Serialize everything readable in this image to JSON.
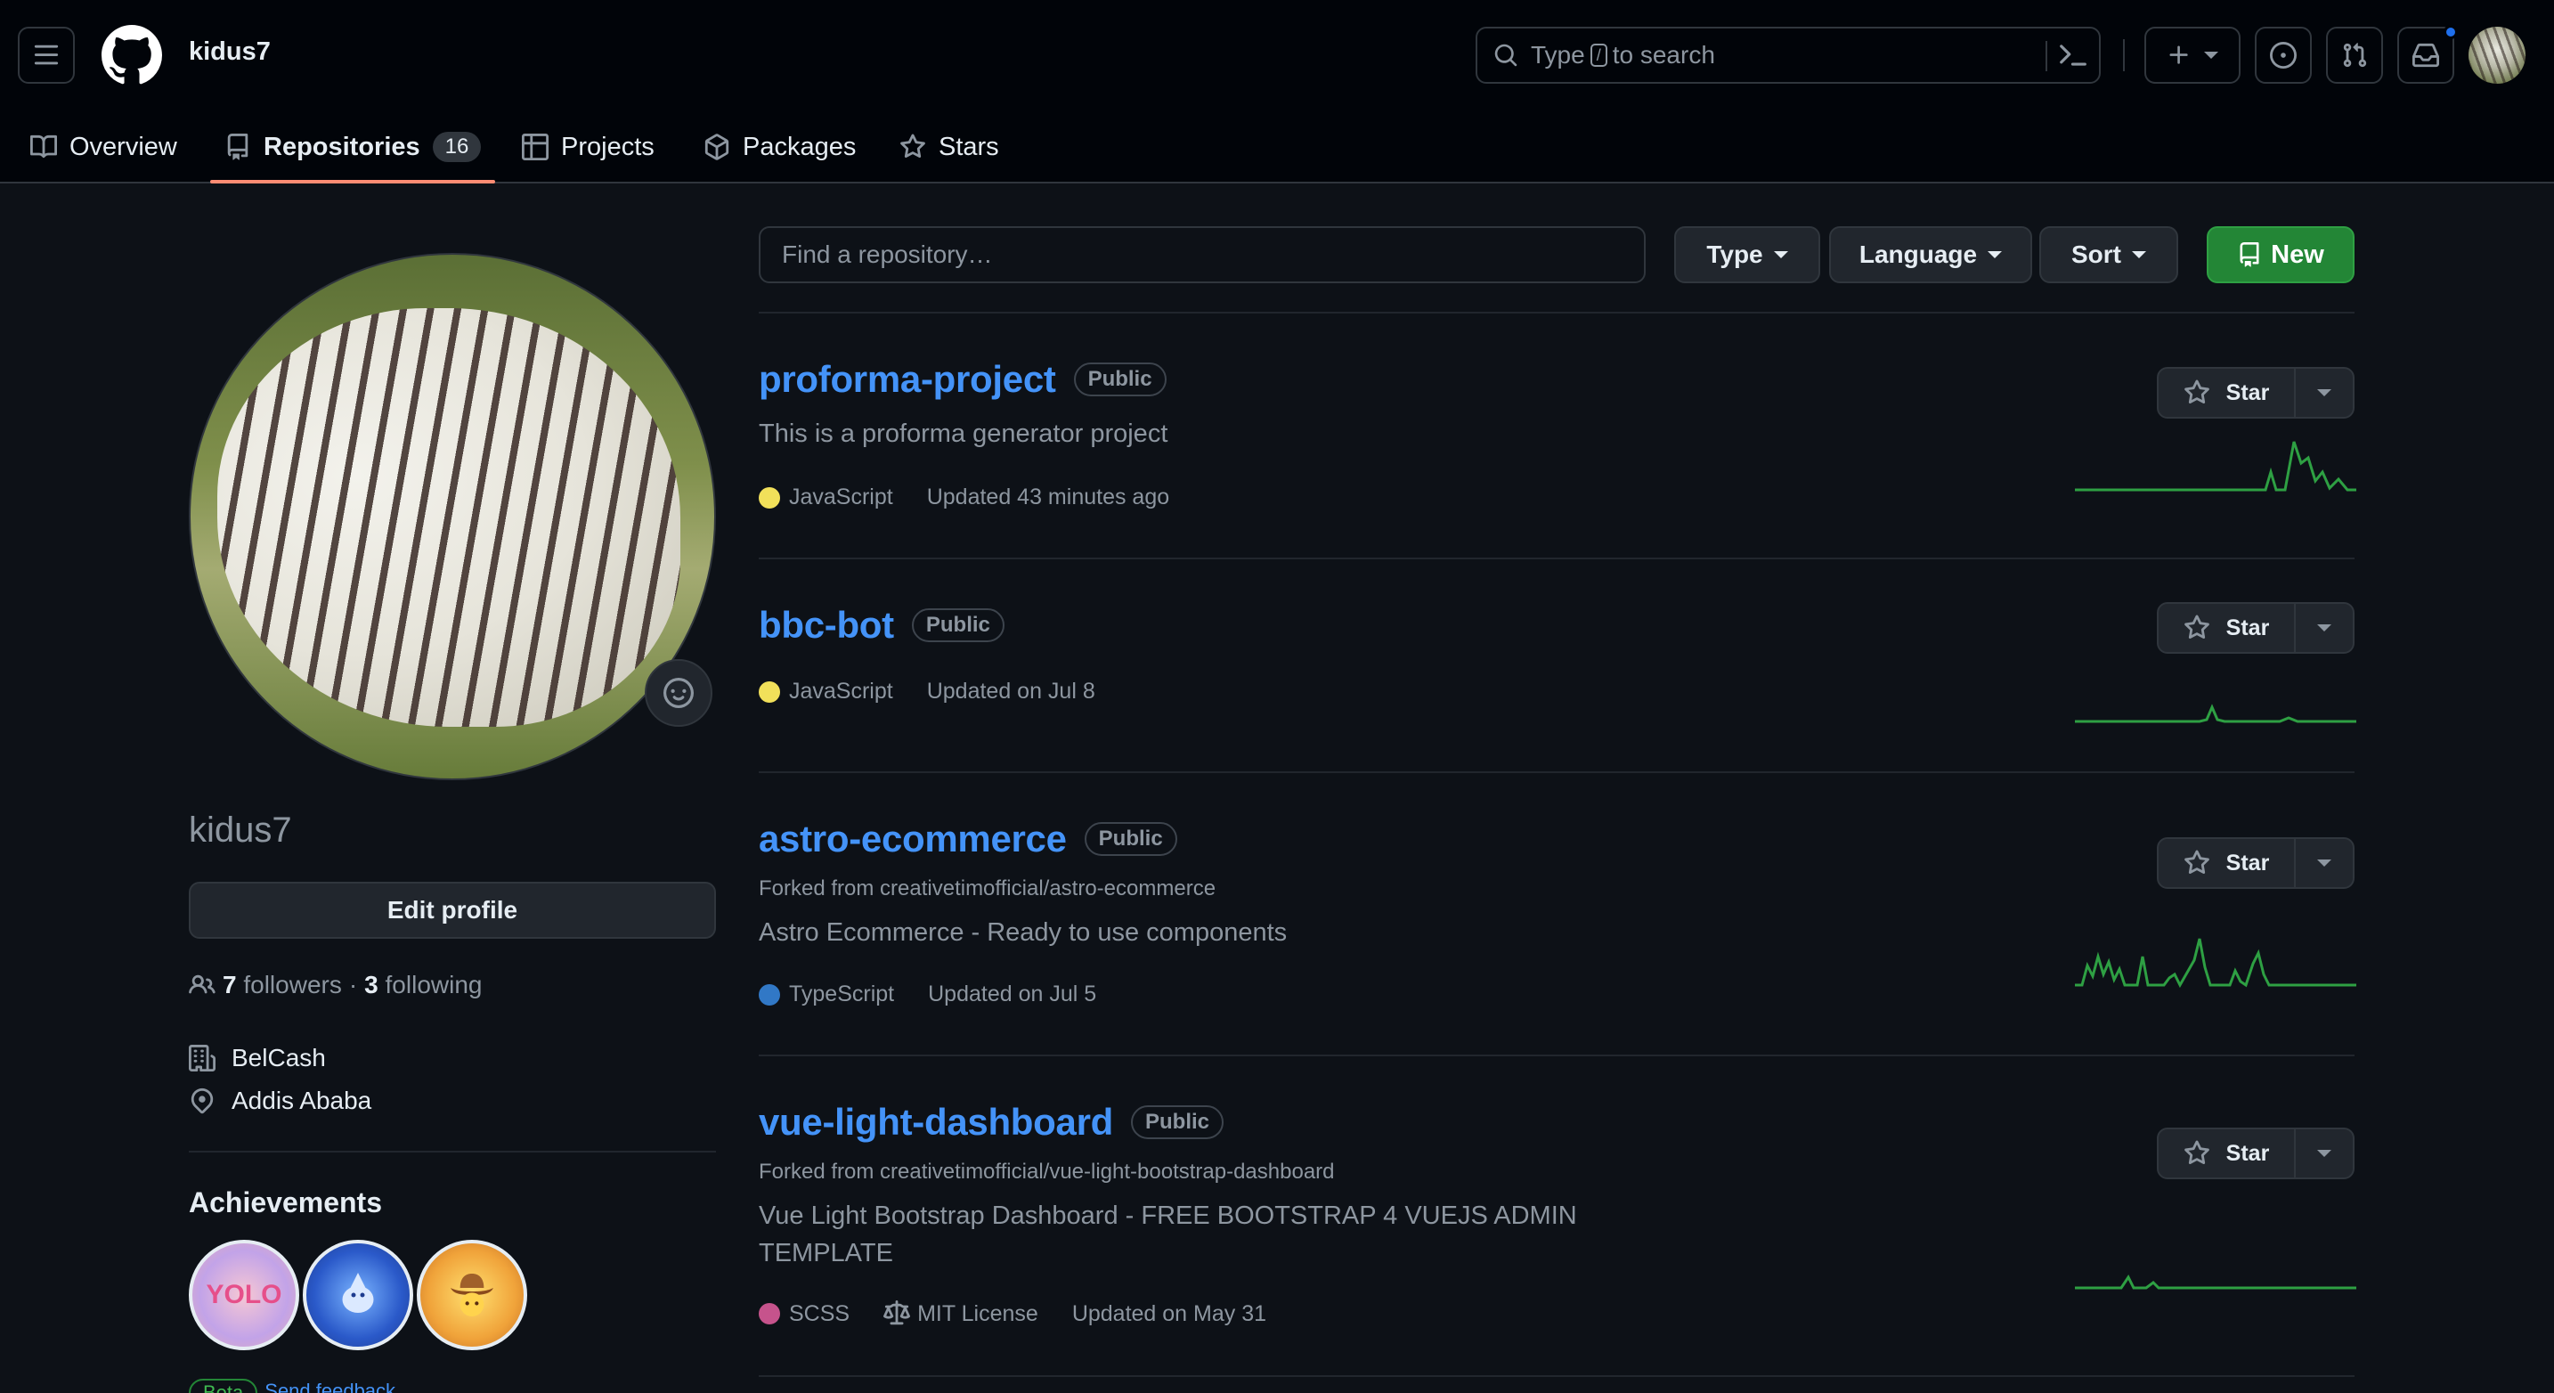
{
  "header": {
    "username": "kidus7",
    "search_prefix": "Type",
    "search_key": "/",
    "search_suffix": "to search"
  },
  "tabs": [
    {
      "label": "Overview"
    },
    {
      "label": "Repositories",
      "count": "16"
    },
    {
      "label": "Projects"
    },
    {
      "label": "Packages"
    },
    {
      "label": "Stars"
    }
  ],
  "profile": {
    "name": "kidus7",
    "edit_label": "Edit profile",
    "followers_count": "7",
    "followers_label": "followers",
    "separator": "·",
    "following_count": "3",
    "following_label": "following",
    "company": "BelCash",
    "location": "Addis Ababa",
    "achievements_title": "Achievements",
    "badges": [
      "YOLO",
      "Pull Shark",
      "Quickdraw"
    ],
    "beta_label": "Beta",
    "feedback_label": "Send feedback"
  },
  "filters": {
    "find_placeholder": "Find a repository…",
    "type_label": "Type",
    "language_label": "Language",
    "sort_label": "Sort",
    "new_label": "New"
  },
  "repos": [
    {
      "name": "proforma-project",
      "visibility": "Public",
      "description": "This is a proforma generator project",
      "language": "JavaScript",
      "language_color": "#f1e05a",
      "updated": "Updated 43 minutes ago",
      "star_label": "Star"
    },
    {
      "name": "bbc-bot",
      "visibility": "Public",
      "language": "JavaScript",
      "language_color": "#f1e05a",
      "updated": "Updated on Jul 8",
      "star_label": "Star"
    },
    {
      "name": "astro-ecommerce",
      "visibility": "Public",
      "forked_from": "Forked from creativetimofficial/astro-ecommerce",
      "description": "Astro Ecommerce - Ready to use components",
      "language": "TypeScript",
      "language_color": "#3178c6",
      "updated": "Updated on Jul 5",
      "star_label": "Star"
    },
    {
      "name": "vue-light-dashboard",
      "visibility": "Public",
      "forked_from": "Forked from creativetimofficial/vue-light-bootstrap-dashboard",
      "description": "Vue Light Bootstrap Dashboard - FREE BOOTSTRAP 4 VUEJS ADMIN TEMPLATE",
      "language": "SCSS",
      "language_color": "#c6538c",
      "license": "MIT License",
      "updated": "Updated on May 31",
      "star_label": "Star"
    }
  ],
  "colors": {
    "background": "#0d1117",
    "header": "#010409",
    "link": "#4493f8",
    "accent_underline": "#fd8c73",
    "new_button": "#238636",
    "sparkline": "#2ea043"
  }
}
